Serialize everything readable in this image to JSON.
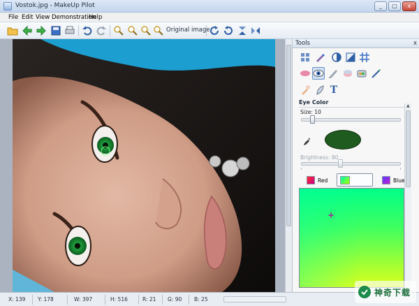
{
  "window": {
    "title": "Vostok.jpg - MakeUp Pilot",
    "min": "_",
    "max": "□",
    "close": "x"
  },
  "menu": [
    "File",
    "Edit",
    "View",
    "Demonstration",
    "Help"
  ],
  "toolbar": {
    "original_image_label": "Original image",
    "icons": [
      "open-icon",
      "back-icon",
      "forward-icon",
      "save-icon",
      "print-icon",
      "undo-icon",
      "redo-icon",
      "zoom-in-icon",
      "zoom-out-icon",
      "zoom-fit-icon",
      "zoom-actual-icon",
      "rotate-right-icon",
      "rotate-left-icon",
      "flip-vertical-icon",
      "flip-horizontal-icon"
    ]
  },
  "tools": {
    "title": "Tools",
    "close": "x",
    "section_title": "Eye Color",
    "size_label": "Size: 10",
    "size_value": 10,
    "brightness_label": "Brightness: 80",
    "brightness_value": 80,
    "swatch_color": "#1f5a1f",
    "channels": {
      "red": "Red",
      "blue": "Blue"
    },
    "text_tool_glyph": "T"
  },
  "status": {
    "x": "X: 139",
    "y": "Y: 178",
    "w": "W: 397",
    "h": "H: 516",
    "r": "R: 21",
    "g": "G: 90",
    "b": "B: 25"
  },
  "watermark": {
    "text": "神奇下载"
  },
  "colors": {
    "accent": "#5b86c5",
    "eye_green": "#22b04a",
    "swatch": "#1f5a1f"
  }
}
